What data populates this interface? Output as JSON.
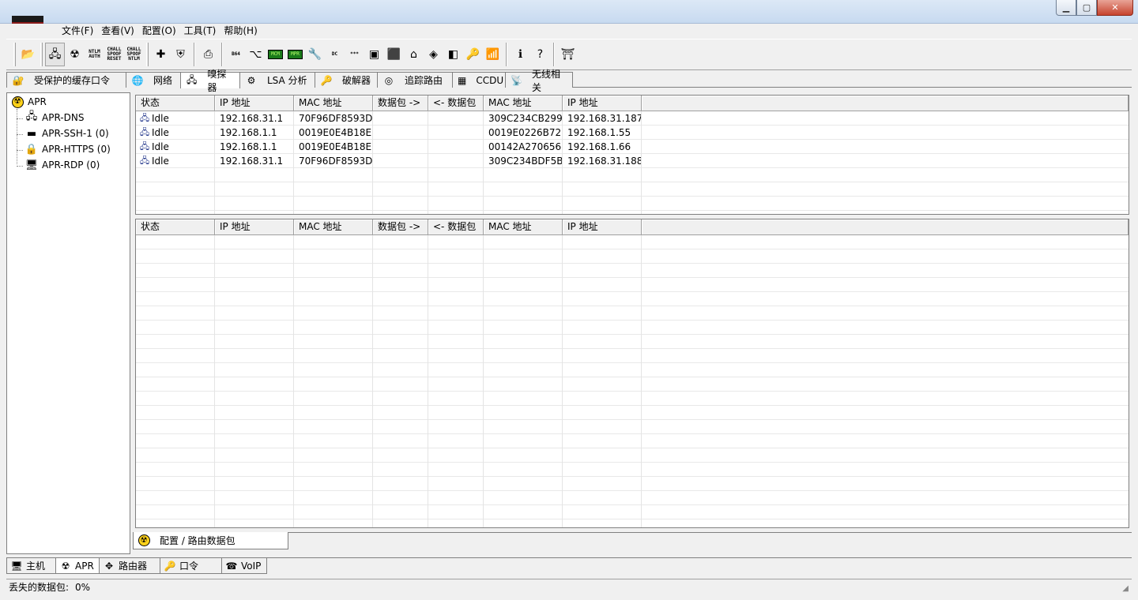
{
  "window": {
    "min_glyph": "▁",
    "max_glyph": "▢",
    "close_glyph": "✕"
  },
  "menu": [
    "文件(F)",
    "查看(V)",
    "配置(O)",
    "工具(T)",
    "帮助(H)"
  ],
  "toolbar": {
    "items": [
      {
        "name": "open-icon",
        "glyph": "📂"
      },
      {
        "name": "sniffer-icon",
        "glyph": "🖧"
      },
      {
        "name": "apr-icon",
        "glyph": "☢"
      },
      {
        "name": "ntlm-auth-icon",
        "text": "NTLM AUTH"
      },
      {
        "name": "chall-spoof-reset-icon",
        "text": "CHALL SPOOF RESET"
      },
      {
        "name": "chall-spoof-ntlm-icon",
        "text": "CHALL SPOOF NTLM"
      },
      {
        "name": "add-icon",
        "glyph": "✚"
      },
      {
        "name": "shield-icon",
        "glyph": "⛨"
      },
      {
        "name": "export-icon",
        "glyph": "⎙"
      },
      {
        "name": "base64-icon",
        "text": "B64"
      },
      {
        "name": "decoder-icon",
        "glyph": "⌥"
      },
      {
        "name": "hash-calc-icon",
        "box": "MCM"
      },
      {
        "name": "mpr-icon",
        "box": "MPR"
      },
      {
        "name": "wrench-icon",
        "glyph": "🔧"
      },
      {
        "name": "dc-icon",
        "text": "DC"
      },
      {
        "name": "password-mask-icon",
        "text": "***"
      },
      {
        "name": "terminal-icon",
        "glyph": "▣"
      },
      {
        "name": "stop-icon",
        "glyph": "⬛"
      },
      {
        "name": "house-icon",
        "glyph": "⌂"
      },
      {
        "name": "spoof-icon",
        "glyph": "◈"
      },
      {
        "name": "database-icon",
        "glyph": "◧"
      },
      {
        "name": "key-icon",
        "glyph": "🔑"
      },
      {
        "name": "wireless-icon",
        "glyph": "📶"
      },
      {
        "name": "info-icon",
        "glyph": "ℹ"
      },
      {
        "name": "help-icon",
        "glyph": "?"
      },
      {
        "name": "exit-icon",
        "glyph": "⛩"
      }
    ]
  },
  "main_tabs": [
    {
      "label": "受保护的缓存口令",
      "icon": "🔐",
      "name": "tab-protected-storage"
    },
    {
      "label": "网络",
      "icon": "🌐",
      "name": "tab-network"
    },
    {
      "label": "嗅探器",
      "icon": "🖧",
      "name": "tab-sniffer",
      "active": true
    },
    {
      "label": "LSA 分析",
      "icon": "⚙",
      "name": "tab-lsa"
    },
    {
      "label": "破解器",
      "icon": "🔑",
      "name": "tab-cracker"
    },
    {
      "label": "追踪路由",
      "icon": "◎",
      "name": "tab-traceroute"
    },
    {
      "label": "CCDU",
      "icon": "▦",
      "name": "tab-ccdu"
    },
    {
      "label": "无线相关",
      "icon": "📡",
      "name": "tab-wireless"
    }
  ],
  "tree": {
    "root": "APR",
    "children": [
      {
        "label": "APR-DNS",
        "icon": "🖧",
        "name": "tree-apr-dns"
      },
      {
        "label": "APR-SSH-1 (0)",
        "icon": "▬",
        "name": "tree-apr-ssh"
      },
      {
        "label": "APR-HTTPS (0)",
        "icon": "🔒",
        "name": "tree-apr-https"
      },
      {
        "label": "APR-RDP (0)",
        "icon": "🖥",
        "name": "tree-apr-rdp"
      }
    ]
  },
  "columns": [
    "状态",
    "IP 地址",
    "MAC 地址",
    "数据包 ->",
    "<- 数据包",
    "MAC 地址",
    "IP 地址"
  ],
  "top_rows": [
    [
      "Idle",
      "192.168.31.1",
      "70F96DF8593D",
      "",
      "",
      "309C234CB299",
      "192.168.31.187"
    ],
    [
      "Idle",
      "192.168.1.1",
      "0019E0E4B18E",
      "",
      "",
      "0019E0226B72",
      "192.168.1.55"
    ],
    [
      "Idle",
      "192.168.1.1",
      "0019E0E4B18E",
      "",
      "",
      "00142A270656",
      "192.168.1.66"
    ],
    [
      "Idle",
      "192.168.31.1",
      "70F96DF8593D",
      "",
      "",
      "309C234BDF5B",
      "192.168.31.188"
    ]
  ],
  "bottom_rows": [],
  "subtab": {
    "label": "配置 / 路由数据包"
  },
  "bottom_tabs": [
    {
      "label": "主机",
      "icon": "🖥",
      "name": "btab-hosts"
    },
    {
      "label": "APR",
      "icon": "☢",
      "name": "btab-apr",
      "active": true
    },
    {
      "label": "路由器",
      "icon": "✥",
      "name": "btab-routers"
    },
    {
      "label": "口令",
      "icon": "🔑",
      "name": "btab-passwords"
    },
    {
      "label": "VoIP",
      "icon": "☎",
      "name": "btab-voip"
    }
  ],
  "status": {
    "label": "丢失的数据包:",
    "value": "0%"
  }
}
